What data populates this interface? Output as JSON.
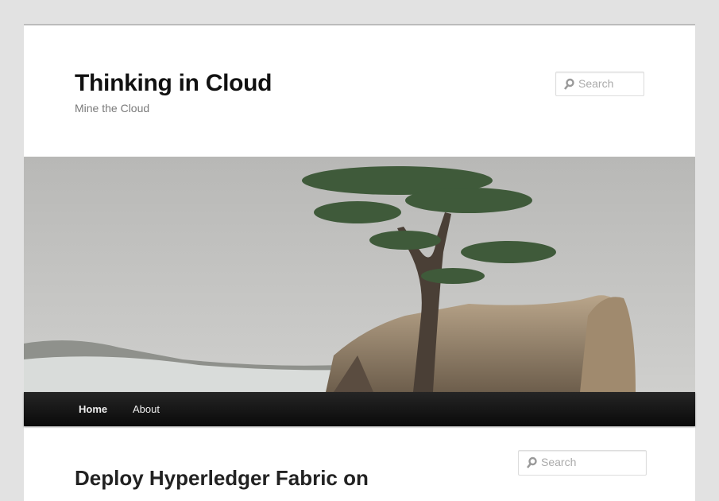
{
  "site": {
    "title": "Thinking in Cloud",
    "tagline": "Mine the Cloud"
  },
  "header_search": {
    "placeholder": "Search"
  },
  "nav": {
    "items": [
      {
        "label": "Home"
      },
      {
        "label": "About"
      }
    ]
  },
  "sidebar_search": {
    "placeholder": "Search"
  },
  "post": {
    "title": "Deploy Hyperledger Fabric on"
  }
}
